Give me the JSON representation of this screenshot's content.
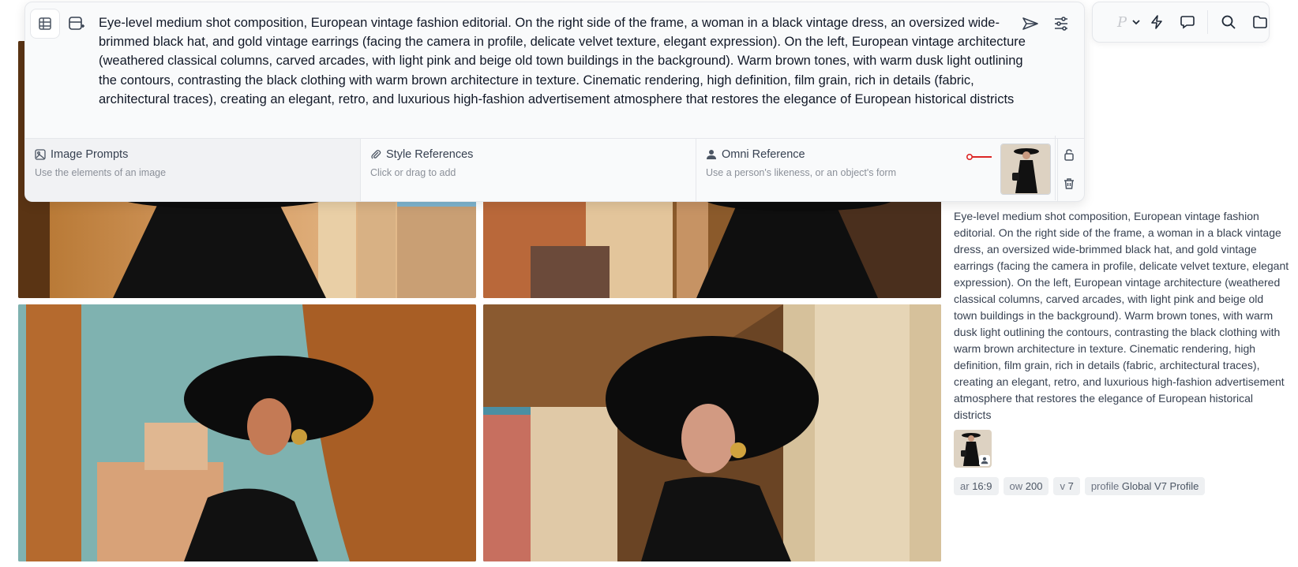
{
  "prompt": {
    "text": "Eye-level medium shot composition, European vintage fashion editorial. On the right side of the frame, a woman in a black vintage dress, an oversized wide-brimmed black hat, and gold vintage earrings (facing the camera in profile, delicate velvet texture, elegant expression). On the left, European vintage architecture (weathered classical columns, carved arcades, with light pink and beige old town buildings in the background). Warm brown tones, with warm dusk light outlining the contours, contrasting the black clothing with warm brown architecture in texture. Cinematic rendering, high definition, film grain, rich in details (fabric, architectural traces), creating an elegant, retro, and luxurious high-fashion advertisement atmosphere that restores the elegance of European historical districts"
  },
  "references": {
    "image_prompts": {
      "title": "Image Prompts",
      "subtitle": "Use the elements of an image"
    },
    "style_references": {
      "title": "Style References",
      "subtitle": "Click or drag to add"
    },
    "omni_reference": {
      "title": "Omni Reference",
      "subtitle": "Use a person's likeness, or an object's form"
    }
  },
  "toolbar": {
    "mode_letter": "P"
  },
  "info": {
    "prompt_text": "Eye-level medium shot composition, European vintage fashion editorial. On the right side of the frame, a woman in a black vintage dress, an oversized wide-brimmed black hat, and gold vintage earrings (facing the camera in profile, delicate velvet texture, elegant expression). On the left, European vintage architecture (weathered classical columns, carved arcades, with light pink and beige old town buildings in the background). Warm brown tones, with warm dusk light outlining the contours, contrasting the black clothing with warm brown architecture in texture. Cinematic rendering, high definition, film grain, rich in details (fabric, architectural traces), creating an elegant, retro, and luxurious high-fashion advertisement atmosphere that restores the elegance of European historical districts",
    "params": [
      {
        "key": "ar",
        "value": "16:9"
      },
      {
        "key": "ow",
        "value": "200"
      },
      {
        "key": "v",
        "value": "7"
      },
      {
        "key": "profile",
        "value": "Global V7 Profile"
      }
    ]
  },
  "colors": {
    "accent_slider": "#dc2626",
    "panel_bg": "#f9fafb"
  }
}
